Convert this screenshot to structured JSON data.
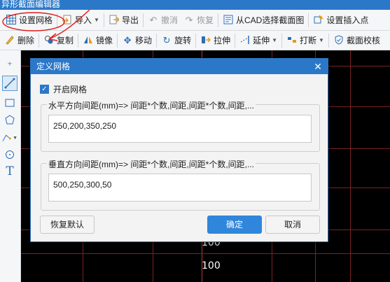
{
  "window": {
    "title": "异形截面编辑器"
  },
  "toolbar1": [
    {
      "key": "grid",
      "label": "设置网格",
      "icon": "grid-icon"
    },
    {
      "key": "import",
      "label": "导入",
      "icon": "import-icon",
      "dropdown": true
    },
    {
      "key": "export",
      "label": "导出",
      "icon": "export-icon"
    },
    {
      "key": "undo",
      "label": "撤消",
      "icon": "undo-icon",
      "disabled": true
    },
    {
      "key": "redo",
      "label": "恢复",
      "icon": "redo-icon",
      "disabled": true
    },
    {
      "key": "cad",
      "label": "从CAD选择截面图",
      "icon": "cad-icon"
    },
    {
      "key": "insert",
      "label": "设置插入点",
      "icon": "insert-point-icon"
    }
  ],
  "toolbar2": [
    {
      "key": "delete",
      "label": "删除",
      "icon": "delete-icon"
    },
    {
      "key": "copy",
      "label": "复制",
      "icon": "copy-icon"
    },
    {
      "key": "mirror",
      "label": "镜像",
      "icon": "mirror-icon"
    },
    {
      "key": "move",
      "label": "移动",
      "icon": "move-icon"
    },
    {
      "key": "rotate",
      "label": "旋转",
      "icon": "rotate-icon"
    },
    {
      "key": "stretch",
      "label": "拉伸",
      "icon": "stretch-icon"
    },
    {
      "key": "extend",
      "label": "延伸",
      "icon": "extend-icon",
      "dropdown": true
    },
    {
      "key": "break",
      "label": "打断",
      "icon": "break-icon",
      "dropdown": true
    },
    {
      "key": "check",
      "label": "截面校核",
      "icon": "section-check-icon"
    }
  ],
  "canvas": {
    "labels": [
      "100",
      "100"
    ]
  },
  "dialog": {
    "title": "定义网格",
    "enable_grid_label": "开启网格",
    "enable_grid_checked": true,
    "horizontal": {
      "label": "水平方向间距(mm)=> 间距*个数,间距,间距*个数,间距,...",
      "value": "250,200,350,250"
    },
    "vertical": {
      "label": "垂直方向间距(mm)=> 间距*个数,间距,间距*个数,间距,...",
      "value": "500,250,300,50"
    },
    "buttons": {
      "reset": "恢复默认",
      "ok": "确定",
      "cancel": "取消"
    }
  },
  "colors": {
    "accent": "#2b78c8",
    "primary_button": "#2f86da",
    "grid_line": "#7a2323",
    "canvas_bg": "#000000",
    "annotation": "#e02020"
  }
}
